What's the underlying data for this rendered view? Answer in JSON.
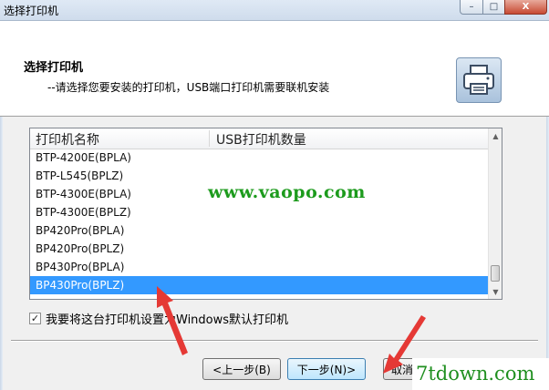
{
  "window": {
    "title": "选择打印机",
    "controls": {
      "minimize": "–",
      "maximize": "□",
      "close": "X"
    }
  },
  "header": {
    "heading": "选择打印机",
    "subheading": "--请选择您要安装的打印机，USB端口打印机需要联机安装",
    "icon": "printer-icon"
  },
  "list": {
    "columns": [
      "打印机名称",
      "USB打印机数量"
    ],
    "rows": [
      "BTP-4200E(BPLA)",
      "BTP-L545(BPLZ)",
      "BTP-4300E(BPLA)",
      "BTP-4300E(BPLZ)",
      "BP420Pro(BPLA)",
      "BP420Pro(BPLZ)",
      "BP430Pro(BPLA)",
      "BP430Pro(BPLZ)"
    ],
    "selected_index": 7,
    "scroll_up": "▲",
    "scroll_down": "▼"
  },
  "checkbox": {
    "checked": true,
    "mark": "✓",
    "label": "我要将这台打印机设置为Windows默认打印机"
  },
  "buttons": {
    "back": "<上一步(B)",
    "next": "下一步(N)>",
    "cancel": "取消"
  },
  "watermarks": {
    "center": "www.vaopo.com",
    "corner": "7tdown.com"
  },
  "colors": {
    "selection": "#3399ff",
    "annotation_arrow": "#e53935",
    "watermark": "#1d9b1d"
  }
}
